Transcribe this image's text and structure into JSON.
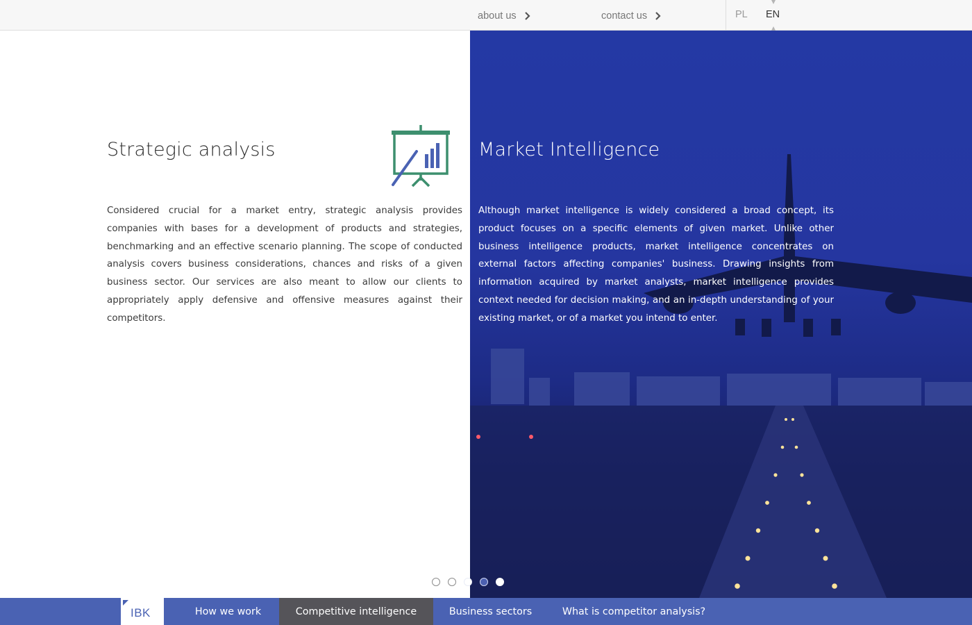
{
  "header": {
    "links": [
      {
        "label": "about us"
      },
      {
        "label": "contact us"
      }
    ],
    "languages": [
      {
        "code": "PL",
        "active": false
      },
      {
        "code": "EN",
        "active": true
      }
    ]
  },
  "left_panel": {
    "title": "Strategic analysis",
    "icon": "presentation-chart-icon",
    "body": "Considered crucial for a market entry, strategic analysis provides companies with bases for a development of products and strategies, benchmarking and an effective scenario planning. The scope of conducted analysis covers business considerations, chances and risks of a given business sector. Our services are also meant to allow our clients to appropriately apply defensive and offensive measures against their competitors."
  },
  "right_panel": {
    "title": "Market Intelligence",
    "body": "Although market intelligence is widely considered a broad concept, its product focuses on a specific elements of given market. Unlike other business intelligence products, market intelligence concentrates on external factors affecting companies' business. Drawing insights from information acquired by market analysts, market intelligence provides context needed for decision making, and an in-depth understanding of your existing market, or of a market you intend to enter.",
    "background_image": "airplane-landing-runway"
  },
  "slider": {
    "dot_count": 5,
    "active_index": 3
  },
  "footer_nav": {
    "logo": "IBK",
    "items": [
      {
        "label": "How we work",
        "active": false
      },
      {
        "label": "Competitive intelligence",
        "active": true
      },
      {
        "label": "Business sectors",
        "active": false
      },
      {
        "label": "What is competitor analysis?",
        "active": false
      }
    ]
  },
  "colors": {
    "brand_blue": "#4a62b3",
    "active_nav": "#555459",
    "icon_green": "#3d8f6e",
    "icon_blue": "#4a62b3"
  }
}
